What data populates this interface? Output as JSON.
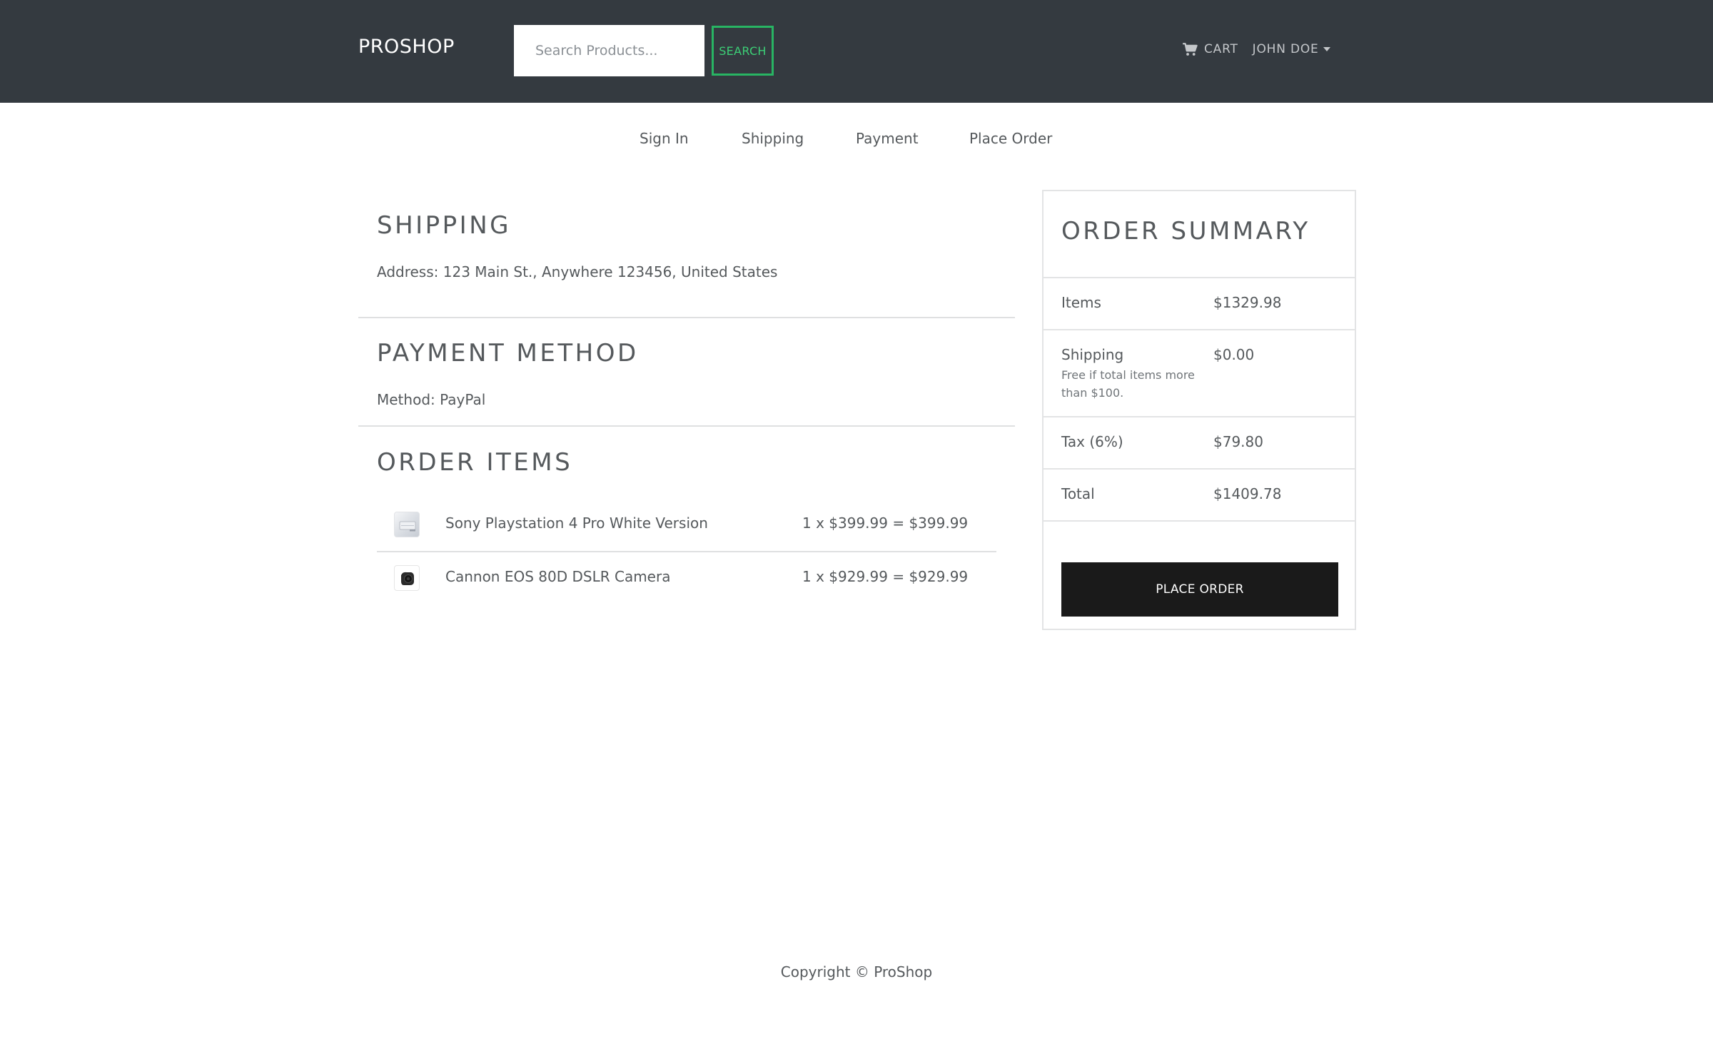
{
  "header": {
    "brand": "PROSHOP",
    "search_placeholder": "Search Products...",
    "search_button": "SEARCH",
    "cart_label": "CART",
    "cart_icon": "shopping-cart-icon",
    "user_name": "JOHN DOE",
    "user_menu_icon": "caret-down-icon"
  },
  "steps": [
    "Sign In",
    "Shipping",
    "Payment",
    "Place Order"
  ],
  "shipping": {
    "title": "SHIPPING",
    "address": "Address: 123 Main St., Anywhere 123456, United States"
  },
  "payment": {
    "title": "PAYMENT METHOD",
    "method": "Method: PayPal"
  },
  "order_items": {
    "title": "ORDER ITEMS",
    "items": [
      {
        "name": "Sony Playstation 4 Pro White Version",
        "price_line": "1 x $399.99 = $399.99"
      },
      {
        "name": "Cannon EOS 80D DSLR Camera",
        "price_line": "1 x $929.99 = $929.99"
      }
    ]
  },
  "summary": {
    "title": "ORDER SUMMARY",
    "items_label": "Items",
    "items_value": "$1329.98",
    "shipping_label": "Shipping",
    "shipping_note": "Free if total items more than $100.",
    "shipping_value": "$0.00",
    "tax_label": "Tax (6%)",
    "tax_value": "$79.80",
    "total_label": "Total",
    "total_value": "$1409.78",
    "place_order_button": "PLACE ORDER"
  },
  "footer": {
    "copyright": "Copyright © ProShop"
  },
  "colors": {
    "navbar": "#343a40",
    "search_accent": "#28b463",
    "text": "#55595c",
    "button_dark": "#1a1a1a"
  }
}
